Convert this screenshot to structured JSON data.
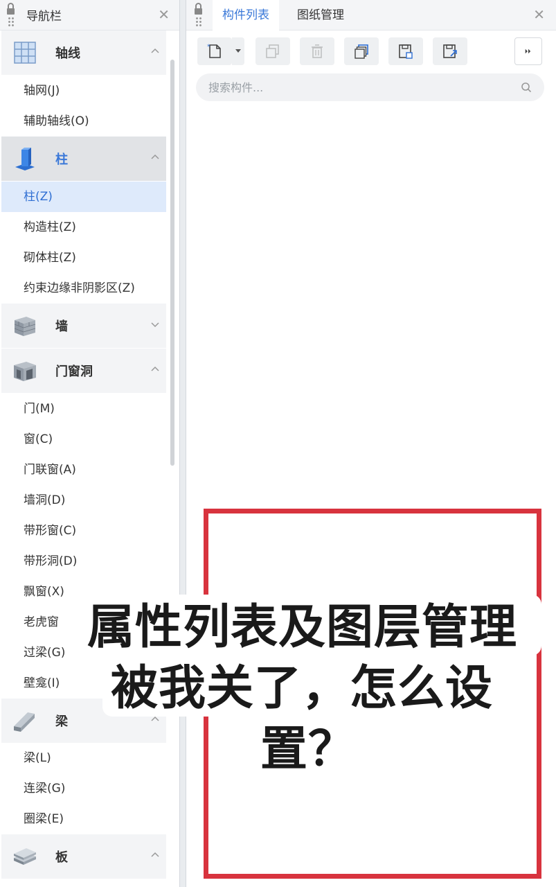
{
  "nav": {
    "title": "导航栏",
    "categories": {
      "axis": {
        "label": "轴线",
        "items": [
          "轴网(J)",
          "辅助轴线(O)"
        ]
      },
      "column": {
        "label": "柱",
        "items": [
          "柱(Z)",
          "构造柱(Z)",
          "砌体柱(Z)",
          "约束边缘非阴影区(Z)"
        ]
      },
      "wall": {
        "label": "墙"
      },
      "opening": {
        "label": "门窗洞",
        "items": [
          "门(M)",
          "窗(C)",
          "门联窗(A)",
          "墙洞(D)",
          "带形窗(C)",
          "带形洞(D)",
          "飘窗(X)",
          "老虎窗",
          "过梁(G)",
          "壁龛(I)"
        ]
      },
      "beam": {
        "label": "梁",
        "items": [
          "梁(L)",
          "连梁(G)",
          "圈梁(E)"
        ]
      },
      "slab": {
        "label": "板"
      }
    },
    "selected_item": "柱(Z)"
  },
  "comp": {
    "tabs": [
      "构件列表",
      "图纸管理"
    ],
    "active_tab": "构件列表",
    "search_placeholder": "搜索构件..."
  },
  "overlay": {
    "caption_lines": [
      "属性列表及图层管理",
      "被我关了，怎么设",
      "置？"
    ],
    "box_color": "#d8333e"
  },
  "colors": {
    "accent": "#3a78d8",
    "selected_bg": "#deeafb"
  }
}
